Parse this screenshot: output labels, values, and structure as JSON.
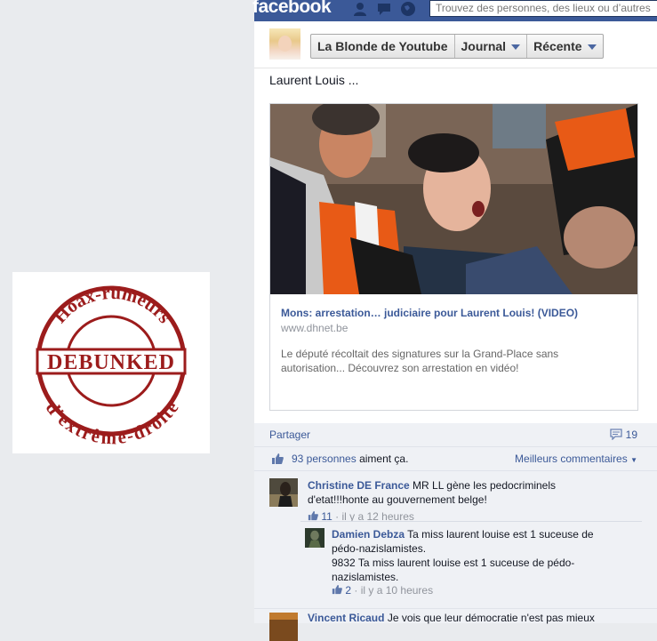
{
  "topbar": {
    "logo": "facebook",
    "search_placeholder": "Trouvez des personnes, des lieux ou d’autres"
  },
  "stamp": {
    "top_arc": "Hoax-rumeurs",
    "center": "DEBUNKED",
    "bottom_arc": "d'extrême-droite"
  },
  "header": {
    "page_name": "La Blonde de Youtube",
    "journal_label": "Journal",
    "recent_label": "Récente"
  },
  "post": {
    "text": "Laurent Louis ...",
    "link": {
      "title": "Mons: arrestation… judiciaire pour Laurent Louis! (VIDEO)",
      "domain": "www.dhnet.be",
      "description": "Le député récoltait des signatures sur la Grand-Place sans autorisation... Découvrez son arrestation en vidéo!"
    }
  },
  "ufi": {
    "share_label": "Partager",
    "comment_count": "19",
    "likes_count_link": "93 personnes",
    "likes_suffix": " aiment ça.",
    "sort_label": "Meilleurs commentaires"
  },
  "comments": [
    {
      "author": "Christine DE France",
      "text": "MR LL gène les pedocriminels d'etat!!!honte au gouvernement belge!",
      "likes": "11",
      "time": "il y a 12 heures",
      "reply": {
        "author": "Damien Debza",
        "text": "Ta miss laurent louise est 1 suceuse de pédo-nazislamistes.",
        "text2": "9832 Ta miss laurent louise est 1 suceuse de pédo-nazislamistes.",
        "likes": "2",
        "time": "il y a 10 heures"
      }
    },
    {
      "author": "Vincent Ricaud",
      "text": "Je vois que leur démocratie n'est pas mieux"
    }
  ],
  "colors": {
    "facebook_blue": "#3b5998",
    "stamp_red": "#9c1c1c"
  }
}
